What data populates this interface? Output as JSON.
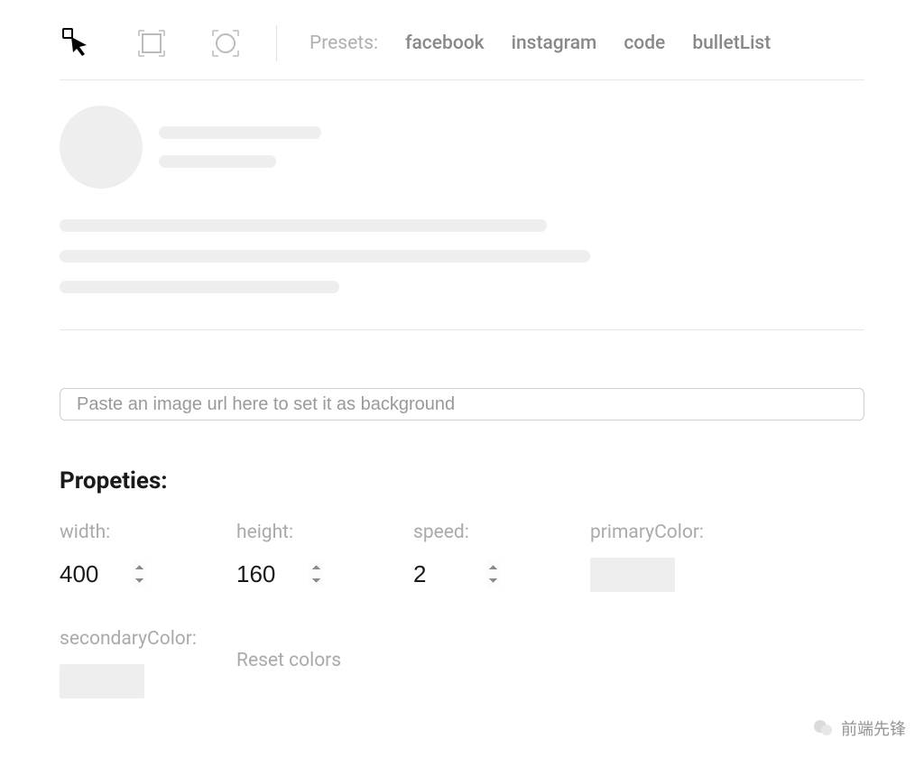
{
  "toolbar": {
    "presets_label": "Presets:",
    "presets": [
      "facebook",
      "instagram",
      "code",
      "bulletList"
    ]
  },
  "url_input": {
    "placeholder": "Paste an image url here to set it as background",
    "value": ""
  },
  "properties": {
    "title": "Propeties:",
    "width": {
      "label": "width:",
      "value": "400"
    },
    "height": {
      "label": "height:",
      "value": "160"
    },
    "speed": {
      "label": "speed:",
      "value": "2"
    },
    "primaryColor": {
      "label": "primaryColor:",
      "value": "#eeeeee"
    },
    "secondaryColor": {
      "label": "secondaryColor:",
      "value": "#eeeeee"
    },
    "reset_label": "Reset colors"
  },
  "watermark": {
    "text": "前端先锋"
  }
}
